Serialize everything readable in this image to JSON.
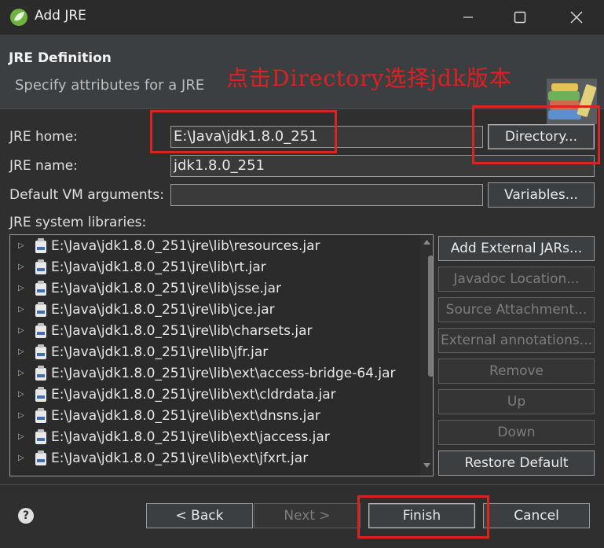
{
  "window": {
    "title": "Add JRE"
  },
  "header": {
    "title": "JRE Definition",
    "description": "Specify attributes for a JRE",
    "annotation": "点击Directory选择jdk版本"
  },
  "form": {
    "jre_home_label": "JRE home:",
    "jre_home_value": "E:\\Java\\jdk1.8.0_251",
    "directory_button": "Directory...",
    "jre_name_label": "JRE name:",
    "jre_name_value": "jdk1.8.0_251",
    "vm_args_label": "Default VM arguments:",
    "vm_args_value": "",
    "variables_button": "Variables...",
    "libraries_label": "JRE system libraries:"
  },
  "libraries": [
    "E:\\Java\\jdk1.8.0_251\\jre\\lib\\resources.jar",
    "E:\\Java\\jdk1.8.0_251\\jre\\lib\\rt.jar",
    "E:\\Java\\jdk1.8.0_251\\jre\\lib\\jsse.jar",
    "E:\\Java\\jdk1.8.0_251\\jre\\lib\\jce.jar",
    "E:\\Java\\jdk1.8.0_251\\jre\\lib\\charsets.jar",
    "E:\\Java\\jdk1.8.0_251\\jre\\lib\\jfr.jar",
    "E:\\Java\\jdk1.8.0_251\\jre\\lib\\ext\\access-bridge-64.jar",
    "E:\\Java\\jdk1.8.0_251\\jre\\lib\\ext\\cldrdata.jar",
    "E:\\Java\\jdk1.8.0_251\\jre\\lib\\ext\\dnsns.jar",
    "E:\\Java\\jdk1.8.0_251\\jre\\lib\\ext\\jaccess.jar",
    "E:\\Java\\jdk1.8.0_251\\jre\\lib\\ext\\jfxrt.jar"
  ],
  "library_buttons": {
    "add_external": "Add External JARs...",
    "javadoc": "Javadoc Location...",
    "source": "Source Attachment...",
    "annotations": "External annotations...",
    "remove": "Remove",
    "up": "Up",
    "down": "Down",
    "restore": "Restore Default"
  },
  "footer": {
    "back": "< Back",
    "next": "Next >",
    "finish": "Finish",
    "cancel": "Cancel"
  },
  "icons": {
    "app": "eclipse-leaf-icon",
    "header": "library-books-icon",
    "help": "help-icon"
  },
  "colors": {
    "highlight": "#d9251f",
    "background": "#2f2f2f"
  }
}
